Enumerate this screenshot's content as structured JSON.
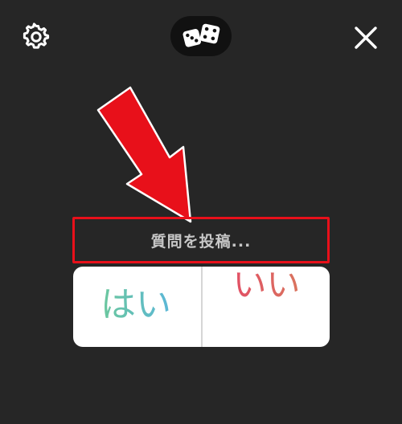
{
  "toolbar": {
    "settings_icon": "gear-icon",
    "dice_icon": "dice-icon",
    "close_icon": "close-icon"
  },
  "question": {
    "placeholder_text": "質問を投稿..."
  },
  "poll": {
    "option_yes": "はい",
    "option_no": "いい"
  },
  "annotation": {
    "arrow_color": "#e8101a",
    "highlight_color": "#e8101a"
  },
  "colors": {
    "background": "#262626",
    "pill": "#111111",
    "card": "#ffffff"
  }
}
